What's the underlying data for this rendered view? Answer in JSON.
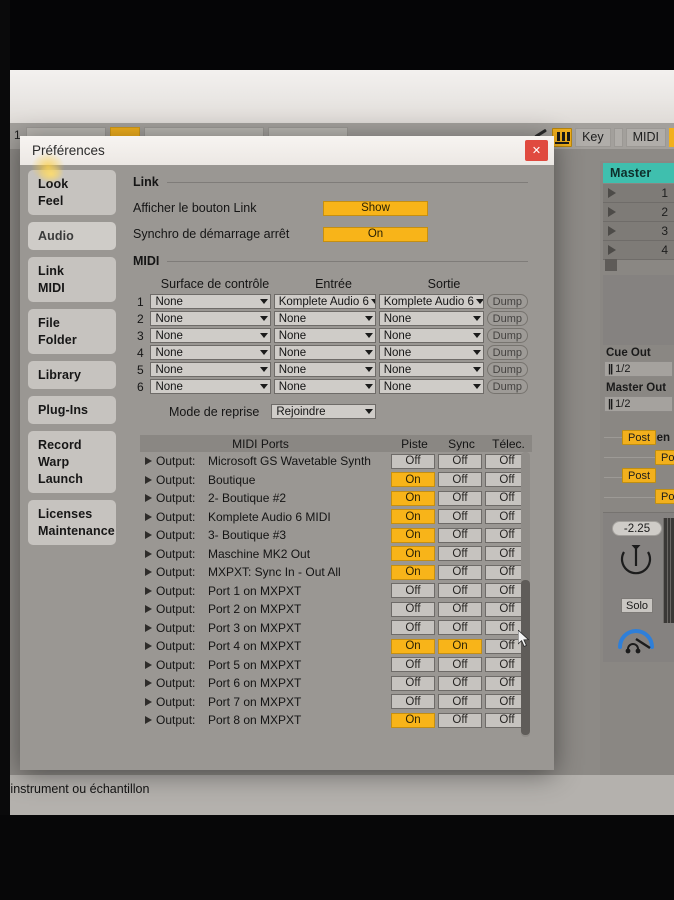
{
  "os_window": {
    "minimize_icon": "minimize-icon",
    "maximize_icon": "maximize-icon"
  },
  "live_toolbar": {
    "track_number": "1",
    "pen_icon": "pen-icon",
    "midi_keys_icon": "piano-keys-icon",
    "key_label": "Key",
    "midi_label": "MIDI"
  },
  "master_panel": {
    "title": "Master",
    "scenes": [
      "1",
      "2",
      "3",
      "4"
    ],
    "stop_icon": "stop-square-icon",
    "cue_out_label": "Cue Out",
    "cue_out_value": "1/2",
    "master_out_label": "Master Out",
    "master_out_value": "1/2",
    "sends_label": "Sen",
    "post_buttons": [
      "Post",
      "Po",
      "Post",
      "Po"
    ],
    "volume_value": "-2.25",
    "pan_knob_icon": "pan-knob-icon",
    "solo_label": "Solo",
    "headphone_knob_icon": "headphone-knob-icon"
  },
  "status_bar": {
    "text": "n instrument ou échantillon"
  },
  "dialog": {
    "title": "Préférences",
    "close_icon": "close-icon",
    "sidebar": [
      {
        "items": [
          "Look",
          "Feel"
        ],
        "active": false
      },
      {
        "items": [
          "Audio"
        ],
        "active": true
      },
      {
        "items": [
          "Link",
          "MIDI"
        ],
        "active": false
      },
      {
        "items": [
          "File",
          "Folder"
        ],
        "active": false
      },
      {
        "items": [
          "Library"
        ],
        "active": false
      },
      {
        "items": [
          "Plug-Ins"
        ],
        "active": false
      },
      {
        "items": [
          "Record",
          "Warp",
          "Launch"
        ],
        "active": false
      },
      {
        "items": [
          "Licenses",
          "Maintenance"
        ],
        "active": false
      }
    ],
    "link_section": {
      "heading": "Link",
      "rows": [
        {
          "label": "Afficher le bouton Link",
          "value": "Show"
        },
        {
          "label": "Synchro de démarrage arrêt",
          "value": "On"
        }
      ]
    },
    "midi_section": {
      "heading": "MIDI",
      "columns": [
        "Surface de contrôle",
        "Entrée",
        "Sortie"
      ],
      "dump_label": "Dump",
      "rows": [
        {
          "num": "1",
          "surface": "None",
          "input": "Komplete Audio 6",
          "output": "Komplete Audio 6"
        },
        {
          "num": "2",
          "surface": "None",
          "input": "None",
          "output": "None"
        },
        {
          "num": "3",
          "surface": "None",
          "input": "None",
          "output": "None"
        },
        {
          "num": "4",
          "surface": "None",
          "input": "None",
          "output": "None"
        },
        {
          "num": "5",
          "surface": "None",
          "input": "None",
          "output": "None"
        },
        {
          "num": "6",
          "surface": "None",
          "input": "None",
          "output": "None"
        }
      ],
      "takeover_label": "Mode de reprise",
      "takeover_value": "Rejoindre"
    },
    "ports_table": {
      "headers": {
        "name": "MIDI Ports",
        "track": "Piste",
        "sync": "Sync",
        "remote": "Télec."
      },
      "rows": [
        {
          "kind": "Output:",
          "name": "Microsoft GS Wavetable Synth",
          "track": "Off",
          "sync": "Off",
          "remote": "Off"
        },
        {
          "kind": "Output:",
          "name": "Boutique",
          "track": "On",
          "sync": "Off",
          "remote": "Off"
        },
        {
          "kind": "Output:",
          "name": "2- Boutique #2",
          "track": "On",
          "sync": "Off",
          "remote": "Off"
        },
        {
          "kind": "Output:",
          "name": "Komplete Audio 6 MIDI",
          "track": "On",
          "sync": "Off",
          "remote": "Off"
        },
        {
          "kind": "Output:",
          "name": "3- Boutique #3",
          "track": "On",
          "sync": "Off",
          "remote": "Off"
        },
        {
          "kind": "Output:",
          "name": "Maschine MK2 Out",
          "track": "On",
          "sync": "Off",
          "remote": "Off"
        },
        {
          "kind": "Output:",
          "name": "MXPXT: Sync In - Out All",
          "track": "On",
          "sync": "Off",
          "remote": "Off"
        },
        {
          "kind": "Output:",
          "name": "Port 1 on MXPXT",
          "track": "Off",
          "sync": "Off",
          "remote": "Off"
        },
        {
          "kind": "Output:",
          "name": "Port 2 on MXPXT",
          "track": "Off",
          "sync": "Off",
          "remote": "Off"
        },
        {
          "kind": "Output:",
          "name": "Port 3 on MXPXT",
          "track": "Off",
          "sync": "Off",
          "remote": "Off"
        },
        {
          "kind": "Output:",
          "name": "Port 4 on MXPXT",
          "track": "On",
          "sync": "On",
          "remote": "Off"
        },
        {
          "kind": "Output:",
          "name": "Port 5 on MXPXT",
          "track": "Off",
          "sync": "Off",
          "remote": "Off"
        },
        {
          "kind": "Output:",
          "name": "Port 6 on MXPXT",
          "track": "Off",
          "sync": "Off",
          "remote": "Off"
        },
        {
          "kind": "Output:",
          "name": "Port 7 on MXPXT",
          "track": "Off",
          "sync": "Off",
          "remote": "Off"
        },
        {
          "kind": "Output:",
          "name": "Port 8 on MXPXT",
          "track": "On",
          "sync": "Off",
          "remote": "Off"
        }
      ]
    }
  },
  "colors": {
    "amber": "#f8b419",
    "master_teal": "#3fbfae",
    "close_red": "#e04a3f",
    "panel_gray": "#9a9793"
  }
}
